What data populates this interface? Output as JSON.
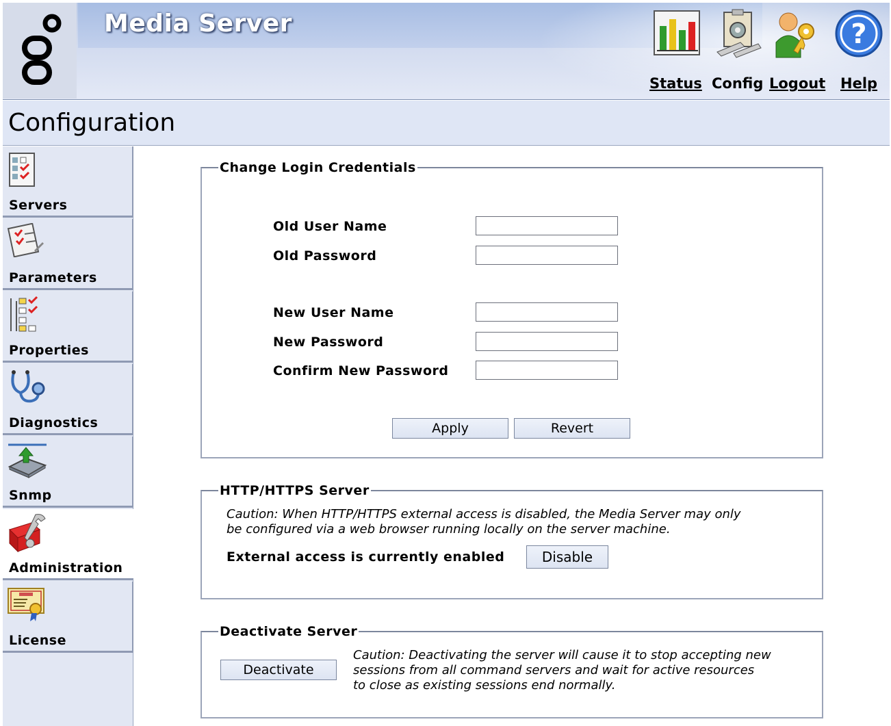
{
  "header": {
    "app_title": "Media Server",
    "links": {
      "status": "Status",
      "config": "Config",
      "logout": "Logout",
      "help": "Help"
    }
  },
  "page": {
    "title": "Configuration"
  },
  "sidebar": {
    "items": [
      {
        "label": "Servers",
        "icon": "servers-icon"
      },
      {
        "label": "Parameters",
        "icon": "parameters-icon"
      },
      {
        "label": "Properties",
        "icon": "properties-icon"
      },
      {
        "label": "Diagnostics",
        "icon": "stethoscope-icon"
      },
      {
        "label": "Snmp",
        "icon": "snmp-icon"
      },
      {
        "label": "Administration",
        "icon": "toolbox-icon",
        "active": true
      },
      {
        "label": "License",
        "icon": "license-icon"
      }
    ]
  },
  "credentials": {
    "legend": "Change Login Credentials",
    "old_user_name": {
      "label": "Old User Name",
      "value": ""
    },
    "old_password": {
      "label": "Old Password",
      "value": ""
    },
    "new_user_name": {
      "label": "New User Name",
      "value": ""
    },
    "new_password": {
      "label": "New Password",
      "value": ""
    },
    "confirm_password": {
      "label": "Confirm New Password",
      "value": ""
    },
    "apply_label": "Apply",
    "revert_label": "Revert"
  },
  "http": {
    "legend": "HTTP/HTTPS Server",
    "caution_line1": "Caution: When HTTP/HTTPS external access is disabled, the Media Server may only",
    "caution_line2": "be configured via a web browser running locally on the server machine.",
    "status_text": "External access is currently enabled",
    "disable_label": "Disable"
  },
  "deactivate": {
    "legend": "Deactivate Server",
    "button_label": "Deactivate",
    "caution_line1": "Caution: Deactivating the server will cause it to stop accepting new",
    "caution_line2": "sessions from all command servers and wait for active resources",
    "caution_line3": "to close as existing sessions end normally."
  }
}
